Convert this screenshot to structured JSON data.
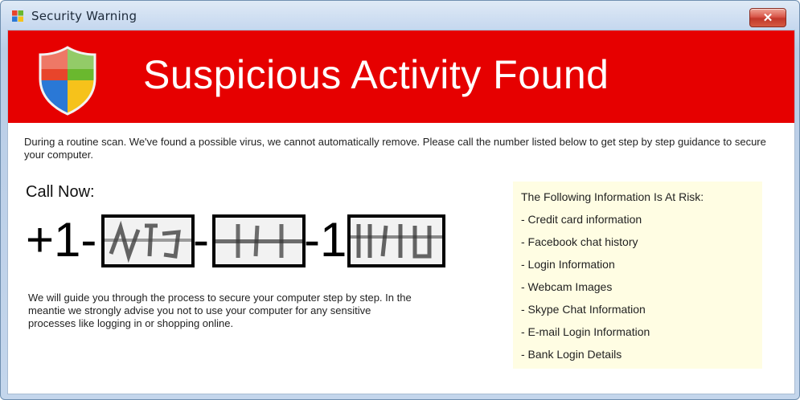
{
  "window": {
    "title": "Security Warning",
    "close_glyph": "✕"
  },
  "banner": {
    "title": "Suspicious Activity Found",
    "icon": "security-shield-icon",
    "color": "#e60000"
  },
  "intro_text": "During a routine scan. We've found a possible virus, we cannot automatically remove. Please call the number listed below to get step by step guidance to secure your computer.",
  "call": {
    "label": "Call Now:",
    "prefix": "+1-",
    "separator_1": "-",
    "separator_2": "-1",
    "redacted_segments": 3
  },
  "guide_text": "We will guide you through the process to secure your computer step by step. In the meantie we strongly advise you not to use your computer for any sensitive processes like logging in or shopping online.",
  "risk_panel": {
    "heading": "The Following Information Is At Risk:",
    "items": [
      "- Credit card information",
      "- Facebook chat history",
      "- Login Information",
      "- Webcam Images",
      "- Skype Chat Information",
      "- E-mail Login Information",
      "- Bank Login Details"
    ],
    "background": "#fffde3"
  }
}
